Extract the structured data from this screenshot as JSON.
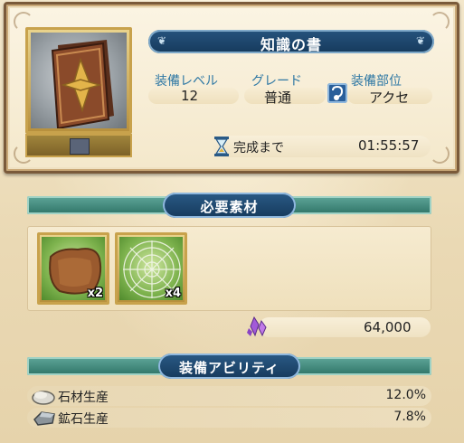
{
  "item": {
    "name": "知識の書",
    "stats": [
      {
        "label": "装備レベル",
        "value": "12"
      },
      {
        "label": "グレード",
        "value": "普通"
      },
      {
        "label": "装備部位",
        "value": "アクセ"
      }
    ],
    "timer_label": "完成まで",
    "timer_value": "01:55:57"
  },
  "materials": {
    "header": "必要素材",
    "items": [
      {
        "icon": "leather-icon",
        "count": "x2"
      },
      {
        "icon": "spider-web-icon",
        "count": "x4"
      }
    ],
    "cost_icon": "purple-crystal-icon",
    "cost_value": "64,000"
  },
  "abilities": {
    "header": "装備アビリティ",
    "rows": [
      {
        "icon": "stone-icon",
        "name": "石材生産",
        "value": "12.0%"
      },
      {
        "icon": "ore-icon",
        "name": "鉱石生産",
        "value": "7.8%"
      }
    ]
  },
  "colors": {
    "accent_blue": "#163a5c",
    "label_blue": "#2f78a4",
    "frame_gold": "#c8a24c",
    "teal_decor": "#2f7467"
  }
}
